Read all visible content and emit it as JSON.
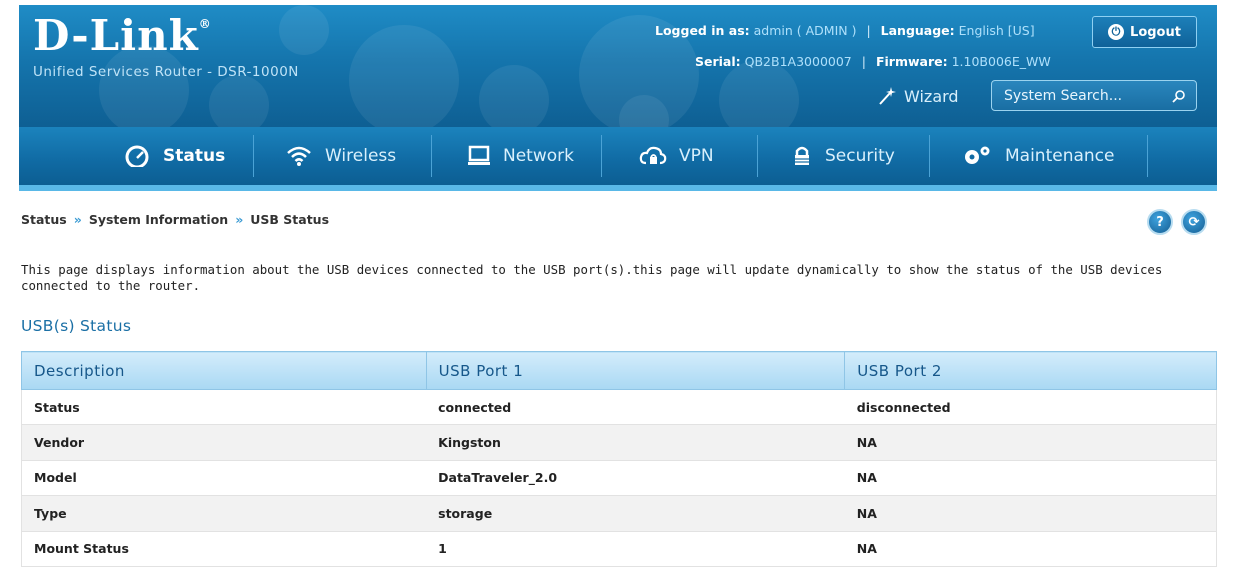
{
  "header": {
    "logo": "D-Link",
    "logo_mark": "®",
    "product": "Unified Services Router - DSR-1000N",
    "logged_in_label": "Logged in as:",
    "logged_in_value": "admin ( ADMIN )",
    "language_label": "Language:",
    "language_value": "English [US]",
    "serial_label": "Serial:",
    "serial_value": "QB2B1A3000007",
    "firmware_label": "Firmware:",
    "firmware_value": "1.10B006E_WW",
    "logout_label": "Logout",
    "wizard_label": "Wizard",
    "search_placeholder": "System Search..."
  },
  "nav": {
    "items": [
      {
        "label": "Status",
        "icon": "speedometer-icon",
        "active": true
      },
      {
        "label": "Wireless",
        "icon": "wifi-icon",
        "active": false
      },
      {
        "label": "Network",
        "icon": "monitor-icon",
        "active": false
      },
      {
        "label": "VPN",
        "icon": "cloud-lock-icon",
        "active": false
      },
      {
        "label": "Security",
        "icon": "padlock-icon",
        "active": false
      },
      {
        "label": "Maintenance",
        "icon": "gears-icon",
        "active": false
      }
    ]
  },
  "breadcrumb": [
    "Status",
    "System Information",
    "USB Status"
  ],
  "breadcrumb_separator": "»",
  "help_button": "?",
  "refresh_button": "⟳",
  "description": "This page displays information about the USB devices connected to the USB port(s).this page will update dynamically to show the status of the USB devices connected to the router.",
  "section_title": "USB(s) Status",
  "table": {
    "headers": [
      "Description",
      "USB Port 1",
      "USB Port 2"
    ],
    "rows": [
      [
        "Status",
        "connected",
        "disconnected"
      ],
      [
        "Vendor",
        "Kingston",
        "NA"
      ],
      [
        "Model",
        "DataTraveler_2.0",
        "NA"
      ],
      [
        "Type",
        "storage",
        "NA"
      ],
      [
        "Mount Status",
        "1",
        "NA"
      ]
    ]
  },
  "colors": {
    "header_blue": "#1575ad",
    "accent_light_blue": "#59b8e7",
    "title_blue": "#1a6fa5"
  }
}
